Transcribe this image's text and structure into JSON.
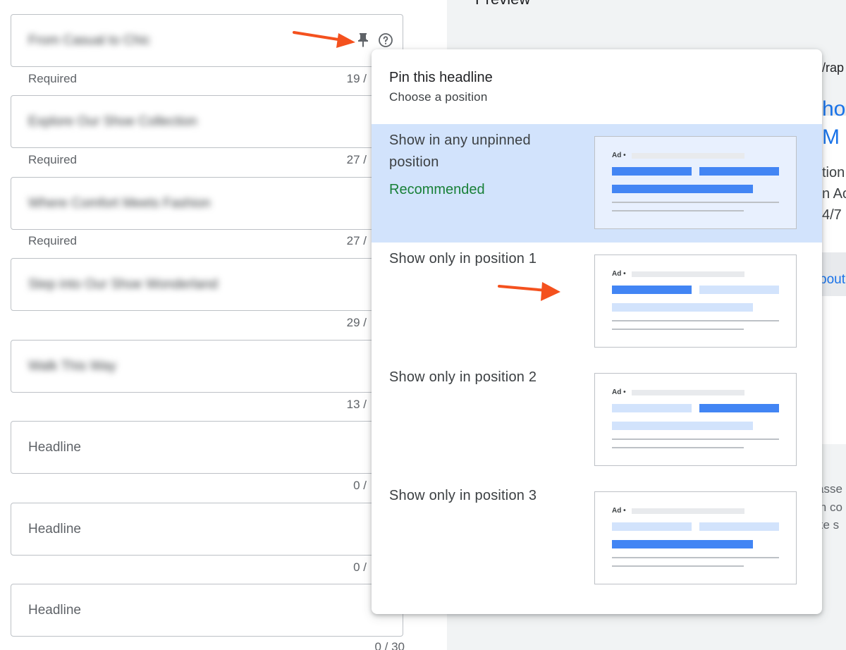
{
  "preview": {
    "title": "Preview",
    "url_fragment": "/rap",
    "headline_fragment_1": "ho",
    "headline_fragment_2": "M",
    "desc_fragment_1": "tion",
    "desc_fragment_2": "n Ac",
    "desc_fragment_3": "4/7",
    "link_fragment": "bout",
    "note_fragment_1": "asse",
    "note_fragment_2": "in co",
    "note_fragment_3": "ke s"
  },
  "fields": [
    {
      "value": "From Casual to Chic",
      "helper": "Required",
      "count": "19 /",
      "blurred": true
    },
    {
      "value": "Explore Our Shoe Collection",
      "helper": "Required",
      "count": "27 /",
      "blurred": true
    },
    {
      "value": "Where Comfort Meets Fashion",
      "helper": "Required",
      "count": "27 /",
      "blurred": true
    },
    {
      "value": "Step into Our Shoe Wonderland",
      "helper": "",
      "count": "29 /",
      "blurred": true
    },
    {
      "value": "Walk This Way",
      "helper": "",
      "count": "13 /",
      "blurred": true
    },
    {
      "placeholder": "Headline",
      "helper": "",
      "count": "0 /"
    },
    {
      "placeholder": "Headline",
      "helper": "",
      "count": "0 /"
    },
    {
      "placeholder": "Headline",
      "helper": "",
      "count": "0 / 30"
    }
  ],
  "pin_popup": {
    "title": "Pin this headline",
    "subtitle": "Choose a position",
    "options": [
      {
        "label": "Show in any unpinned position",
        "badge": "Recommended",
        "selected": true,
        "ad_label": "Ad •"
      },
      {
        "label": "Show only in position 1",
        "selected": false,
        "ad_label": "Ad •"
      },
      {
        "label": "Show only in position 2",
        "selected": false,
        "ad_label": "Ad •"
      },
      {
        "label": "Show only in position 3",
        "selected": false,
        "ad_label": "Ad •"
      }
    ]
  },
  "colors": {
    "accent": "#1a73e8",
    "selected_bg": "#d2e3fc",
    "recommended": "#188038",
    "arrow": "#f4511e",
    "thumb_dark": "#4285f4",
    "thumb_light": "#d2e3fc"
  },
  "icons": {
    "pin": "pin-icon",
    "help": "help-circle-icon",
    "annotation_arrow": "arrow-right-icon"
  }
}
